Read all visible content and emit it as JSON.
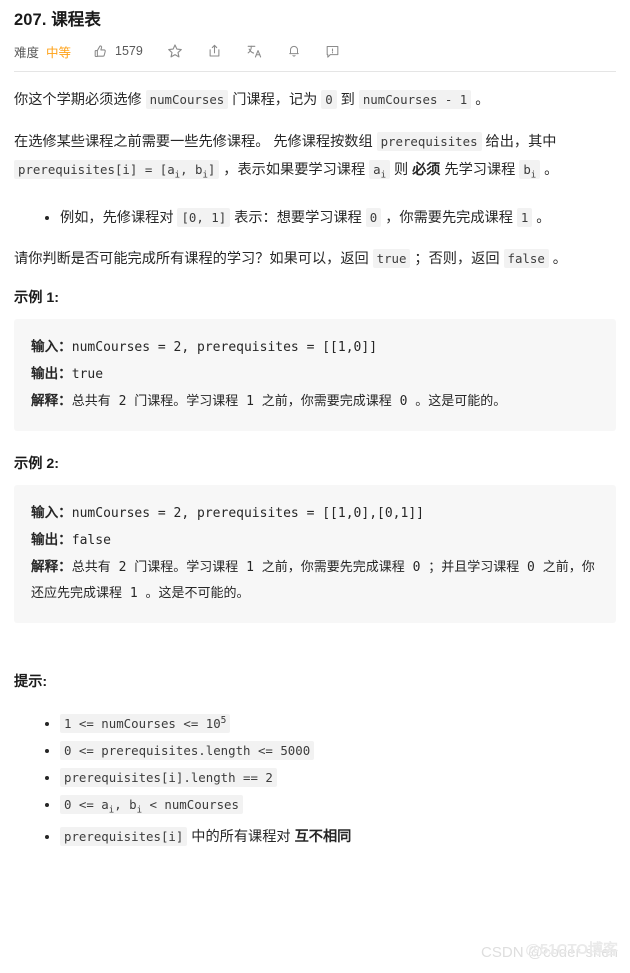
{
  "header": {
    "title": "207. 课程表",
    "difficulty_label": "难度",
    "difficulty_value": "中等",
    "difficulty_color": "#ffa116",
    "like_count": "1579",
    "icons": [
      {
        "name": "thumbs-up-icon",
        "label": "点赞"
      },
      {
        "name": "star-icon",
        "label": "收藏"
      },
      {
        "name": "share-icon",
        "label": "分享"
      },
      {
        "name": "translate-icon",
        "label": "切换语言"
      },
      {
        "name": "bell-icon",
        "label": "订阅"
      },
      {
        "name": "feedback-icon",
        "label": "反馈"
      }
    ]
  },
  "description": {
    "p1": {
      "t1": "你这个学期必须选修 ",
      "c1": "numCourses",
      "t2": " 门课程，记为 ",
      "c2": "0",
      "t3": " 到 ",
      "c3": "numCourses - 1",
      "t4": " 。"
    },
    "p2": {
      "t1": "在选修某些课程之前需要一些先修课程。 先修课程按数组 ",
      "c1": "prerequisites",
      "t2": " 给出，其中 ",
      "c2_pre": "prerequisites[i] = [a",
      "c2_sub1": "i",
      "c2_mid": ", b",
      "c2_sub2": "i",
      "c2_post": "]",
      "t3": " ，表示如果要学习课程 ",
      "c3": "a",
      "c3_sub": "i",
      "t4": " 则 ",
      "bold": "必须",
      "t5": " 先学习课程 ",
      "c4": "b",
      "c4_sub": "i",
      "t6": " 。"
    },
    "bullet1": {
      "t1": "例如，先修课程对 ",
      "c1": "[0, 1]",
      "t2": " 表示：想要学习课程 ",
      "c2": "0",
      "t3": " ，你需要先完成课程 ",
      "c3": "1",
      "t4": " 。"
    },
    "p3": {
      "t1": "请你判断是否可能完成所有课程的学习？如果可以，返回 ",
      "c1": "true",
      "t2": " ；否则，返回 ",
      "c2": "false",
      "t3": " 。"
    }
  },
  "examples": [
    {
      "heading": "示例 1:",
      "input_label": "输入：",
      "input_value": "numCourses = 2, prerequisites = [[1,0]]",
      "output_label": "输出：",
      "output_value": "true",
      "explain_label": "解释：",
      "explain_value": "总共有 2 门课程。学习课程 1 之前，你需要完成课程 0 。这是可能的。"
    },
    {
      "heading": "示例 2:",
      "input_label": "输入：",
      "input_value": "numCourses = 2, prerequisites = [[1,0],[0,1]]",
      "output_label": "输出：",
      "output_value": "false",
      "explain_label": "解释：",
      "explain_value": "总共有 2 门课程。学习课程 1 之前，你需要先完成课程 0 ；并且学习课程 0 之前，你还应先完成课程 1 。这是不可能的。"
    }
  ],
  "hints": {
    "heading": "提示:",
    "items": [
      {
        "pre": "1 <= numCourses <= 10",
        "sup": "5",
        "post": ""
      },
      {
        "pre": "0 <= prerequisites.length <= 5000",
        "sup": "",
        "post": ""
      },
      {
        "pre": "prerequisites[i].length == 2",
        "sup": "",
        "post": ""
      },
      {
        "pre": "0 <= a",
        "sub1": "i",
        "mid": ", b",
        "sub2": "i",
        "post": " < numCourses"
      },
      {
        "code": "prerequisites[i]",
        "text": " 中的所有课程对 ",
        "bold": "互不相同"
      }
    ]
  },
  "watermark": {
    "front": "CSDN @coder-shen",
    "back": "@51CTO博客"
  }
}
